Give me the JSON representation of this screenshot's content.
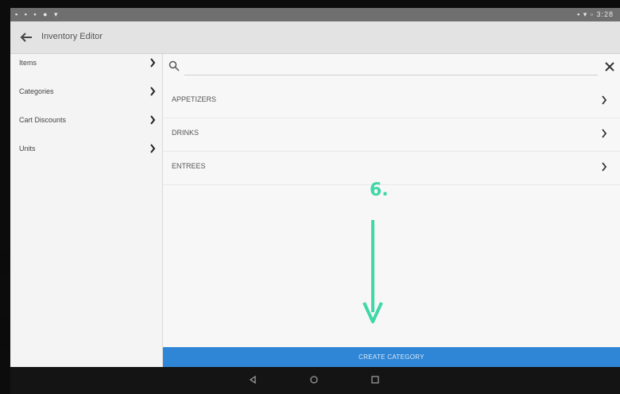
{
  "status_bar": {
    "left_icons": "▪ ▪ ▪ ● ▾",
    "right_icons": "▪ ▾ ▫ 3:28"
  },
  "app_bar": {
    "title": "Inventory Editor",
    "back_icon": "back-arrow-icon"
  },
  "sidebar": {
    "items": [
      {
        "label": "Items"
      },
      {
        "label": "Categories"
      },
      {
        "label": "Cart Discounts"
      },
      {
        "label": "Units"
      }
    ]
  },
  "search": {
    "value": "",
    "placeholder": ""
  },
  "categories": [
    {
      "label": "APPETIZERS"
    },
    {
      "label": "DRINKS"
    },
    {
      "label": "ENTREES"
    }
  ],
  "create_button": {
    "label": "CREATE CATEGORY"
  },
  "annotation": {
    "step_label": "6.",
    "color": "#3ed7a6"
  },
  "colors": {
    "accent": "#2f86d6",
    "app_bar": "#e3e3e3",
    "status_bar": "#6f6f6f"
  }
}
